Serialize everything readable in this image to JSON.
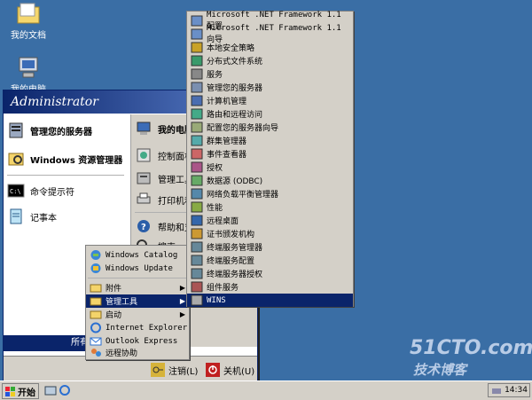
{
  "desktop": {
    "icons": [
      {
        "label": "我的文档",
        "icon": "my-documents-icon"
      },
      {
        "label": "我的电脑",
        "icon": "my-computer-icon"
      }
    ]
  },
  "start_menu": {
    "user": "Administrator",
    "left_items": [
      {
        "label": "管理您的服务器",
        "icon": "server-manage-icon"
      },
      {
        "label": "Windows 资源管理器",
        "icon": "explorer-icon"
      },
      {
        "label": "命令提示符",
        "icon": "cmd-icon"
      },
      {
        "label": "记事本",
        "icon": "notepad-icon"
      }
    ],
    "right_items": [
      {
        "label": "我的电脑",
        "icon": "my-computer-icon"
      },
      {
        "label": "控制面板",
        "icon": "control-panel-icon"
      },
      {
        "label": "管理工具",
        "icon": "admin-tools-icon"
      },
      {
        "label": "打印机和",
        "icon": "printer-icon"
      },
      {
        "label": "帮助和支",
        "icon": "help-icon"
      },
      {
        "label": "搜索",
        "icon": "search-icon"
      }
    ],
    "all_programs": "所有程序 (P)",
    "logoff": "注销(L)",
    "shutdown": "关机(U)"
  },
  "programs_menu": {
    "items": [
      {
        "label": "Windows Catalog",
        "icon": "windows-catalog-icon"
      },
      {
        "label": "Windows Update",
        "icon": "windows-update-icon"
      },
      {
        "label": "附件",
        "icon": "folder-icon",
        "submenu": true
      },
      {
        "label": "管理工具",
        "icon": "folder-icon",
        "submenu": true,
        "selected": true
      },
      {
        "label": "启动",
        "icon": "folder-icon",
        "submenu": true
      },
      {
        "label": "Internet Explorer",
        "icon": "ie-icon"
      },
      {
        "label": "Outlook Express",
        "icon": "outlook-icon"
      },
      {
        "label": "远程协助",
        "icon": "remote-assist-icon"
      }
    ]
  },
  "admin_tools_menu": {
    "items": [
      {
        "label": "Microsoft .NET Framework 1.1 配置",
        "icon": "net-config-icon"
      },
      {
        "label": "Microsoft .NET Framework 1.1 向导",
        "icon": "net-wizard-icon"
      },
      {
        "label": "本地安全策略",
        "icon": "local-security-icon"
      },
      {
        "label": "分布式文件系统",
        "icon": "dfs-icon"
      },
      {
        "label": "服务",
        "icon": "services-icon"
      },
      {
        "label": "管理您的服务器",
        "icon": "server-manage-icon"
      },
      {
        "label": "计算机管理",
        "icon": "computer-management-icon"
      },
      {
        "label": "路由和远程访问",
        "icon": "routing-icon"
      },
      {
        "label": "配置您的服务器向导",
        "icon": "configure-server-icon"
      },
      {
        "label": "群集管理器",
        "icon": "cluster-icon"
      },
      {
        "label": "事件查看器",
        "icon": "event-viewer-icon"
      },
      {
        "label": "授权",
        "icon": "licensing-icon"
      },
      {
        "label": "数据源 (ODBC)",
        "icon": "odbc-icon"
      },
      {
        "label": "网络负载平衡管理器",
        "icon": "nlb-icon"
      },
      {
        "label": "性能",
        "icon": "performance-icon"
      },
      {
        "label": "远程桌面",
        "icon": "remote-desktop-icon"
      },
      {
        "label": "证书颁发机构",
        "icon": "certificate-icon"
      },
      {
        "label": "终端服务管理器",
        "icon": "terminal-manager-icon"
      },
      {
        "label": "终端服务配置",
        "icon": "terminal-config-icon"
      },
      {
        "label": "终端服务器授权",
        "icon": "terminal-license-icon"
      },
      {
        "label": "组件服务",
        "icon": "component-services-icon"
      },
      {
        "label": "WINS",
        "icon": "wins-icon",
        "selected": true
      }
    ]
  },
  "taskbar": {
    "start_label": "开始",
    "clock": "14:34"
  },
  "watermark": {
    "line1": "51CTO.com",
    "line2": "技术博客"
  }
}
